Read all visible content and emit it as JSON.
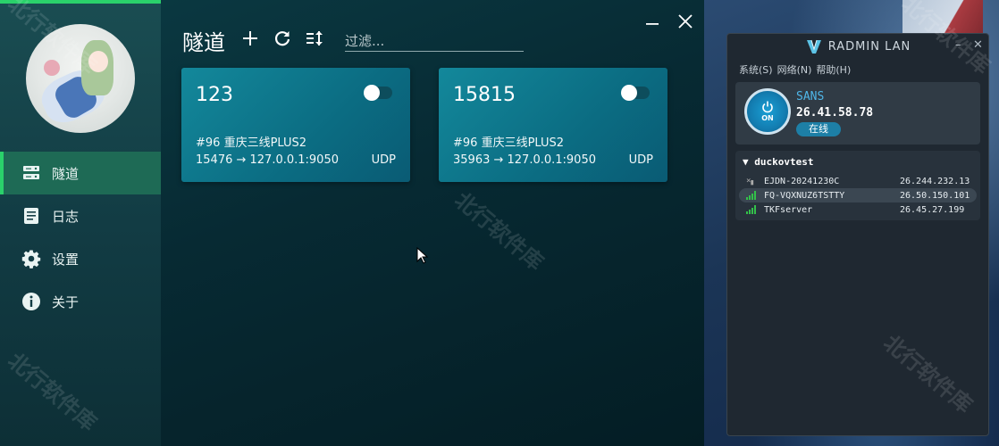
{
  "sidebar": {
    "items": [
      {
        "label": "隧道",
        "icon": "server-icon",
        "active": true
      },
      {
        "label": "日志",
        "icon": "log-icon",
        "active": false
      },
      {
        "label": "设置",
        "icon": "gear-icon",
        "active": false
      },
      {
        "label": "关于",
        "icon": "info-icon",
        "active": false
      }
    ]
  },
  "header": {
    "title": "隧道",
    "filter_placeholder": "过滤..."
  },
  "tunnels": [
    {
      "name": "123",
      "node": "#96 重庆三线PLUS2",
      "mapping": "15476 → 127.0.0.1:9050",
      "protocol": "UDP",
      "enabled": false
    },
    {
      "name": "15815",
      "node": "#96 重庆三线PLUS2",
      "mapping": "35963 → 127.0.0.1:9050",
      "protocol": "UDP",
      "enabled": false
    }
  ],
  "radmin": {
    "title": "RADMIN LAN",
    "menu": [
      "系统(S)",
      "网络(N)",
      "帮助(H)"
    ],
    "self": {
      "name": "SANS",
      "ip": "26.41.58.78",
      "status": "在线",
      "power_label": "ON"
    },
    "network": {
      "name": "duckovtest",
      "peers": [
        {
          "name": "EJDN-20241230C",
          "ip": "26.244.232.13",
          "online": false
        },
        {
          "name": "FQ-VQXNUZ6TSTTY",
          "ip": "26.50.150.101",
          "online": true
        },
        {
          "name": "TKFserver",
          "ip": "26.45.27.199",
          "online": true
        }
      ]
    }
  },
  "watermark": "北行软件库",
  "colors": {
    "accent": "#2ad16b",
    "card": "#0f7c91",
    "radmin_blue": "#1a9fd4"
  }
}
